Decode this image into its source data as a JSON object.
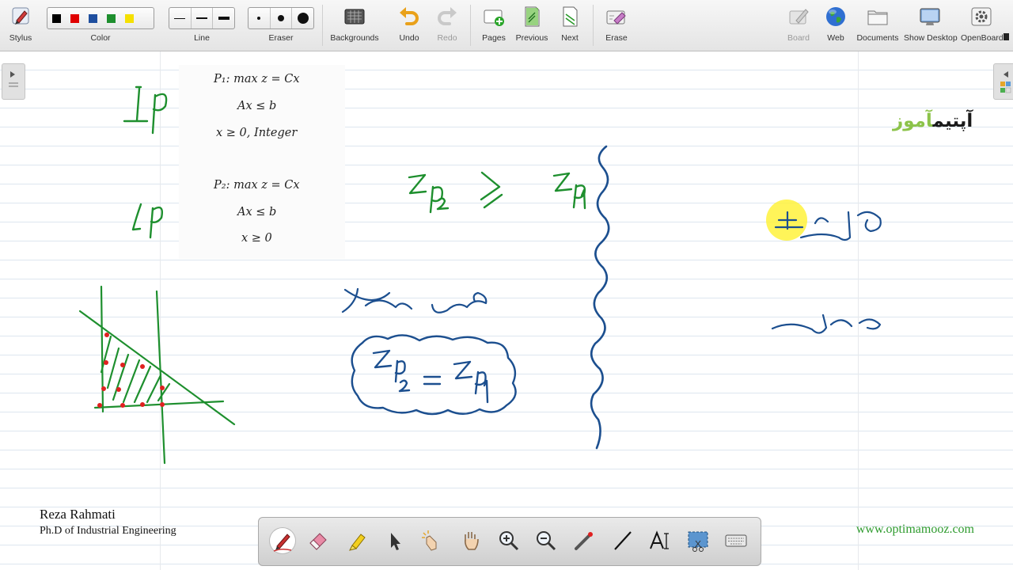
{
  "toolbar": {
    "stylus": "Stylus",
    "color": "Color",
    "line": "Line",
    "eraser": "Eraser",
    "backgrounds": "Backgrounds",
    "undo": "Undo",
    "redo": "Redo",
    "pages": "Pages",
    "previous": "Previous",
    "next": "Next",
    "erase": "Erase",
    "board": "Board",
    "web": "Web",
    "documents": "Documents",
    "show_desktop": "Show Desktop",
    "openboard": "OpenBoard",
    "colors": [
      "#000000",
      "#e00000",
      "#1f4f9f",
      "#1e8f2e",
      "#f5e000"
    ]
  },
  "board": {
    "p1": {
      "line1": "P₁: max z = Cx",
      "line2": "Ax ≤ b",
      "line3": "x ≥ 0, Integer"
    },
    "p2": {
      "line1": "P₂: max z = Cx",
      "line2": "Ax ≤ b",
      "line3": "x ≥ 0"
    },
    "brand_part1": "آپتیم",
    "brand_part2": "آموز",
    "author_name": "Reza Rahmati",
    "author_title": "Ph.D of Industrial Engineering",
    "website": "www.optimamooz.com"
  },
  "dock": {
    "tools": [
      "pen",
      "eraser",
      "highlighter",
      "selector",
      "interactor",
      "hand",
      "zoom-in",
      "zoom-out",
      "laser-pointer",
      "line",
      "text",
      "capture",
      "keyboard"
    ],
    "active_tool": "pen"
  }
}
